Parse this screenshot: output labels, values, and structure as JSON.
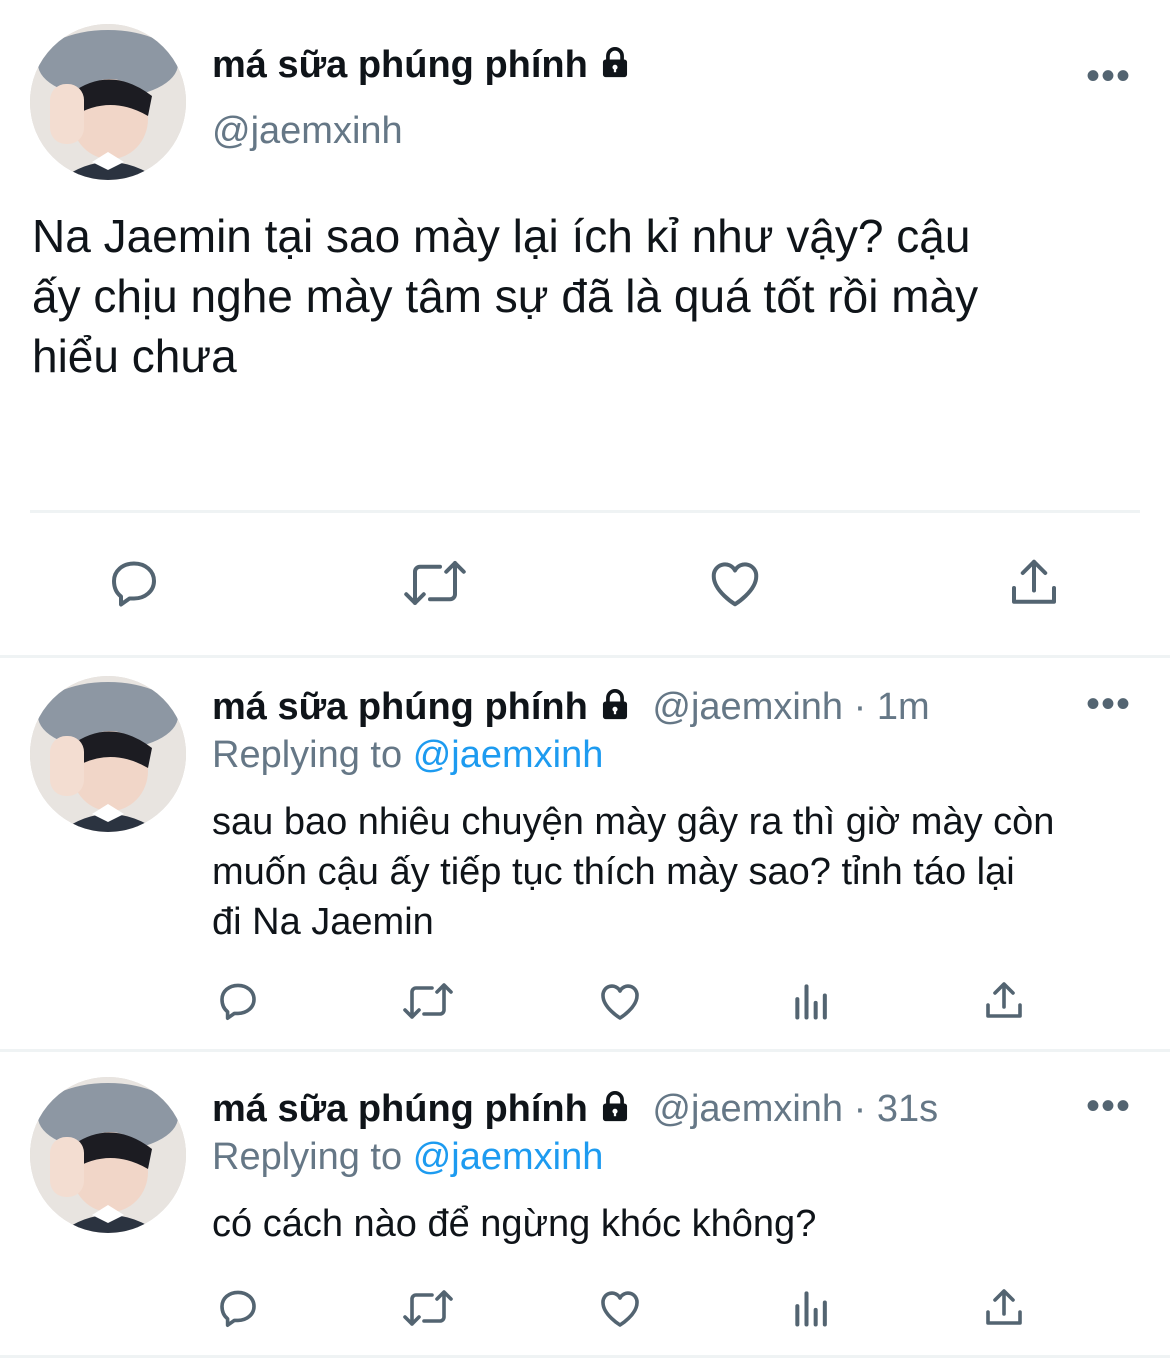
{
  "main_tweet": {
    "display_name": "má sữa phúng phính",
    "handle": "@jaemxinh",
    "text_line1": "Na Jaemin tại sao mày lại ích kỉ như vậy? cậu",
    "text_line2": "ấy chịu nghe mày tâm sự đã là quá tốt rồi mày",
    "text_line3": "hiểu chưa",
    "more": "•••",
    "actions": [
      "reply-icon",
      "retweet-icon",
      "like-icon",
      "share-icon"
    ]
  },
  "replies": [
    {
      "display_name": "má sữa phúng phính",
      "handle": "@jaemxinh",
      "separator": "·",
      "time": "1m",
      "replying_label": "Replying to",
      "replying_handle": "@jaemxinh",
      "text_line1": "sau bao nhiêu chuyện mày gây ra thì giờ mày còn",
      "text_line2": "muốn cậu ấy tiếp tục thích mày sao? tỉnh táo lại",
      "text_line3": "đi Na Jaemin",
      "more": "•••",
      "actions": [
        "reply-icon",
        "retweet-icon",
        "like-icon",
        "analytics-icon",
        "share-icon"
      ]
    },
    {
      "display_name": "má sữa phúng phính",
      "handle": "@jaemxinh",
      "separator": "·",
      "time": "31s",
      "replying_label": "Replying to",
      "replying_handle": "@jaemxinh",
      "text_line1": "có cách nào để ngừng khóc không?",
      "more": "•••",
      "actions": [
        "reply-icon",
        "retweet-icon",
        "like-icon",
        "analytics-icon",
        "share-icon"
      ]
    }
  ],
  "colors": {
    "text": "#0f1419",
    "muted": "#657786",
    "link": "#1d9bf0",
    "icon": "#536471",
    "divider": "#eff3f4"
  }
}
